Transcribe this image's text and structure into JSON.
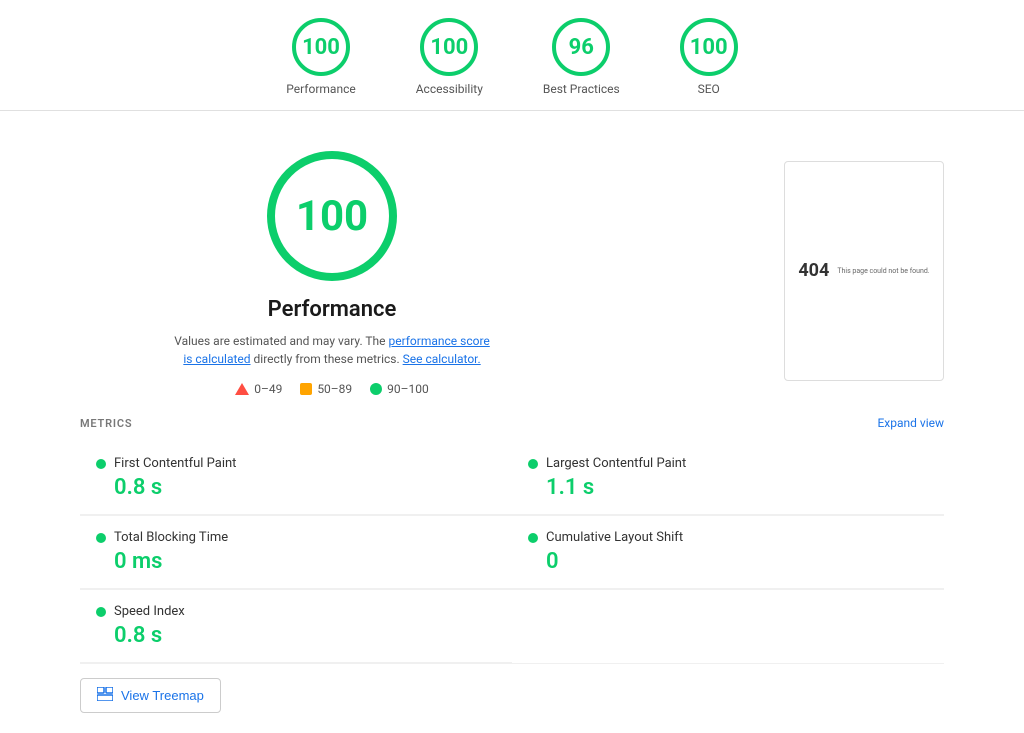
{
  "scores_bar": {
    "items": [
      {
        "id": "performance",
        "score": "100",
        "label": "Performance"
      },
      {
        "id": "accessibility",
        "score": "100",
        "label": "Accessibility"
      },
      {
        "id": "best-practices",
        "score": "96",
        "label": "Best Practices"
      },
      {
        "id": "seo",
        "score": "100",
        "label": "SEO"
      }
    ]
  },
  "main": {
    "big_score": "100",
    "title": "Performance",
    "description_text": "Values are estimated and may vary. The",
    "link1_text": "performance score is calculated",
    "link1_mid": "directly from these metrics.",
    "link2_text": "See calculator.",
    "legend": {
      "range1": "0–49",
      "range2": "50–89",
      "range3": "90–100"
    },
    "screenshot": {
      "code": "404",
      "message": "This page could not be found."
    }
  },
  "metrics": {
    "header": "METRICS",
    "expand_label": "Expand view",
    "items": [
      {
        "id": "fcp",
        "name": "First Contentful Paint",
        "value": "0.8 s"
      },
      {
        "id": "lcp",
        "name": "Largest Contentful Paint",
        "value": "1.1 s"
      },
      {
        "id": "tbt",
        "name": "Total Blocking Time",
        "value": "0 ms"
      },
      {
        "id": "cls",
        "name": "Cumulative Layout Shift",
        "value": "0"
      },
      {
        "id": "si",
        "name": "Speed Index",
        "value": "0.8 s"
      }
    ],
    "treemap_label": "View Treemap"
  }
}
